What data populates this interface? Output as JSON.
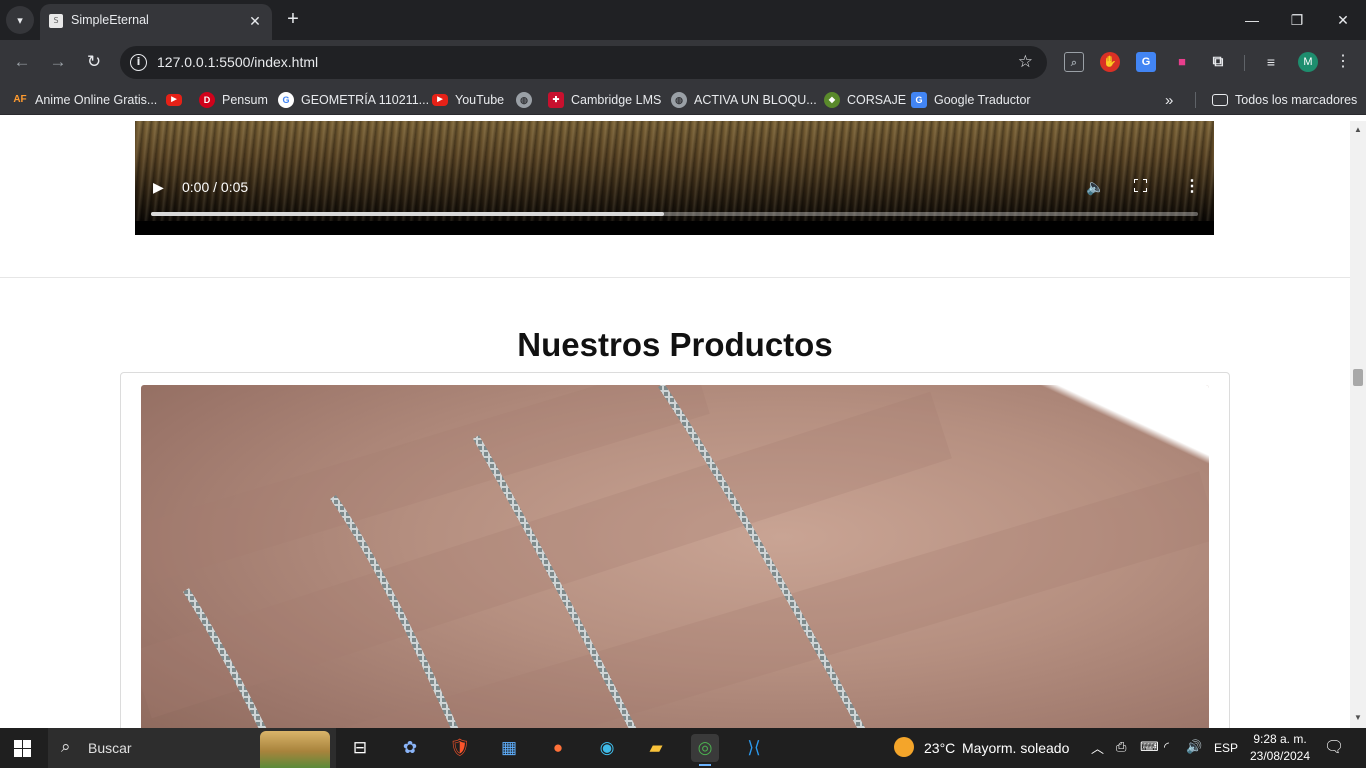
{
  "browser": {
    "tab_title": "SimpleEternal",
    "tab_favicon_letter": "S",
    "url": "127.0.0.1:5500/index.html",
    "profile_initial": "M"
  },
  "bookmarks": {
    "items": [
      {
        "label": "Anime Online Gratis...",
        "icon": "af-icon",
        "icon_text": "AF"
      },
      {
        "label": "",
        "icon": "youtube-icon"
      },
      {
        "label": "Pensum",
        "icon": "pensum-icon",
        "icon_text": "D"
      },
      {
        "label": "GEOMETRÍA 110211...",
        "icon": "google-icon",
        "icon_text": "G"
      },
      {
        "label": "YouTube",
        "icon": "youtube-icon"
      },
      {
        "label": "",
        "icon": "globe-icon"
      },
      {
        "label": "Cambridge LMS",
        "icon": "cambridge-icon"
      },
      {
        "label": "ACTIVA UN BLOQU...",
        "icon": "globe-icon"
      },
      {
        "label": "CORSAJE",
        "icon": "corsaje-icon"
      },
      {
        "label": "Google Traductor",
        "icon": "google-translate-icon",
        "icon_text": "G"
      }
    ],
    "all_bookmarks_label": "Todos los marcadores"
  },
  "video": {
    "time": "0:00 / 0:05",
    "progress_fraction": 0.49
  },
  "page": {
    "section_title": "Nuestros Productos"
  },
  "taskbar": {
    "search_placeholder": "Buscar",
    "weather_temp": "23°C",
    "weather_desc": "Mayorm. soleado",
    "language": "ESP",
    "time": "9:28 a. m.",
    "date": "23/08/2024"
  }
}
